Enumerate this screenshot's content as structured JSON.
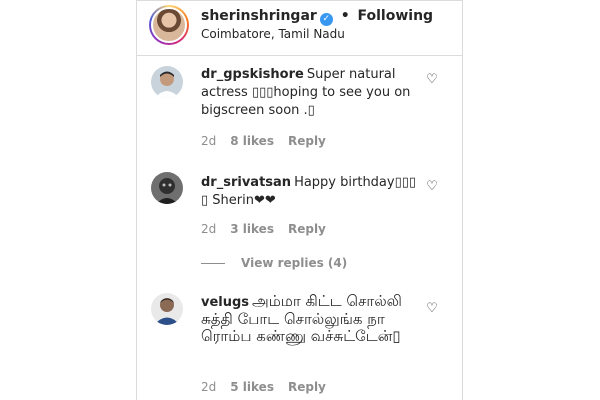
{
  "header": {
    "username": "sherinshringar",
    "verified_mark": "✓",
    "separator": "•",
    "follow_status": "Following",
    "location": "Coimbatore, Tamil Nadu"
  },
  "icons": {
    "heart": "♡"
  },
  "comments": [
    {
      "username": "dr_gpskishore",
      "text": "Super natural actress ▯▯▯hoping to see you on bigscreen soon .▯",
      "age": "2d",
      "likes": "8 likes",
      "reply": "Reply"
    },
    {
      "username": "dr_srivatsan",
      "text": "Happy birthday▯▯▯ ▯ Sherin❤❤",
      "age": "2d",
      "likes": "3 likes",
      "reply": "Reply",
      "view_replies": "View replies (4)"
    },
    {
      "username": "velugs",
      "text": "அம்மா கிட்ட சொல்லி சுத்தி போட சொல்லுங்க நா ரொம்ப கண்ணு வச்சுட்டேன்▯",
      "age": "2d",
      "likes": "5 likes",
      "reply": "Reply"
    }
  ]
}
